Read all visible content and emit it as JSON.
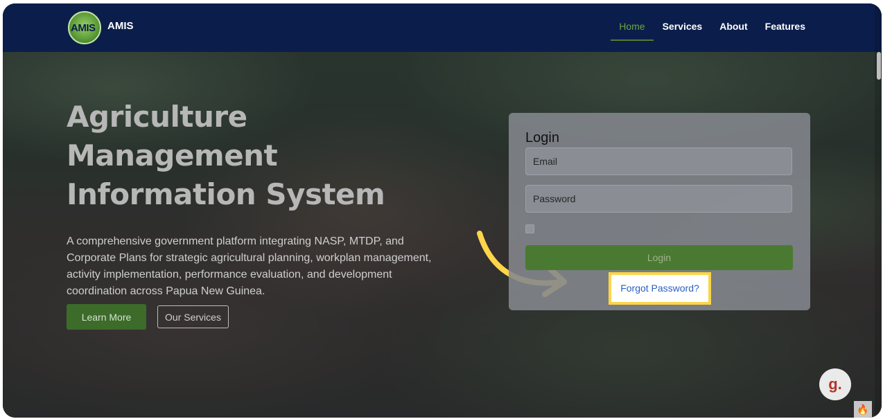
{
  "nav": {
    "logo_text": "AMIS",
    "brand": "AMIS",
    "links": [
      {
        "label": "Home",
        "active": true
      },
      {
        "label": "Services",
        "active": false
      },
      {
        "label": "About",
        "active": false
      },
      {
        "label": "Features",
        "active": false
      }
    ]
  },
  "hero": {
    "title_lines": [
      "Agriculture",
      "Management",
      "Information System"
    ],
    "description": "A comprehensive government platform integrating NASP, MTDP, and Corporate Plans for strategic agricultural planning, workplan management, activity implementation, performance evaluation, and development coordination across Papua New Guinea.",
    "learn_more": "Learn More",
    "our_services": "Our Services"
  },
  "login": {
    "title": "Login",
    "email_placeholder": "Email",
    "password_placeholder": "Password",
    "remember_checked": false,
    "submit": "Login",
    "forgot": "Forgot Password?"
  },
  "widgets": {
    "chat_glyph": "g.",
    "fire_icon": "fire-icon"
  },
  "colors": {
    "navbar": "#0b1e4b",
    "accent_green": "#4a7a32",
    "highlight": "#fbd54a",
    "link_blue": "#2a5fbf"
  }
}
